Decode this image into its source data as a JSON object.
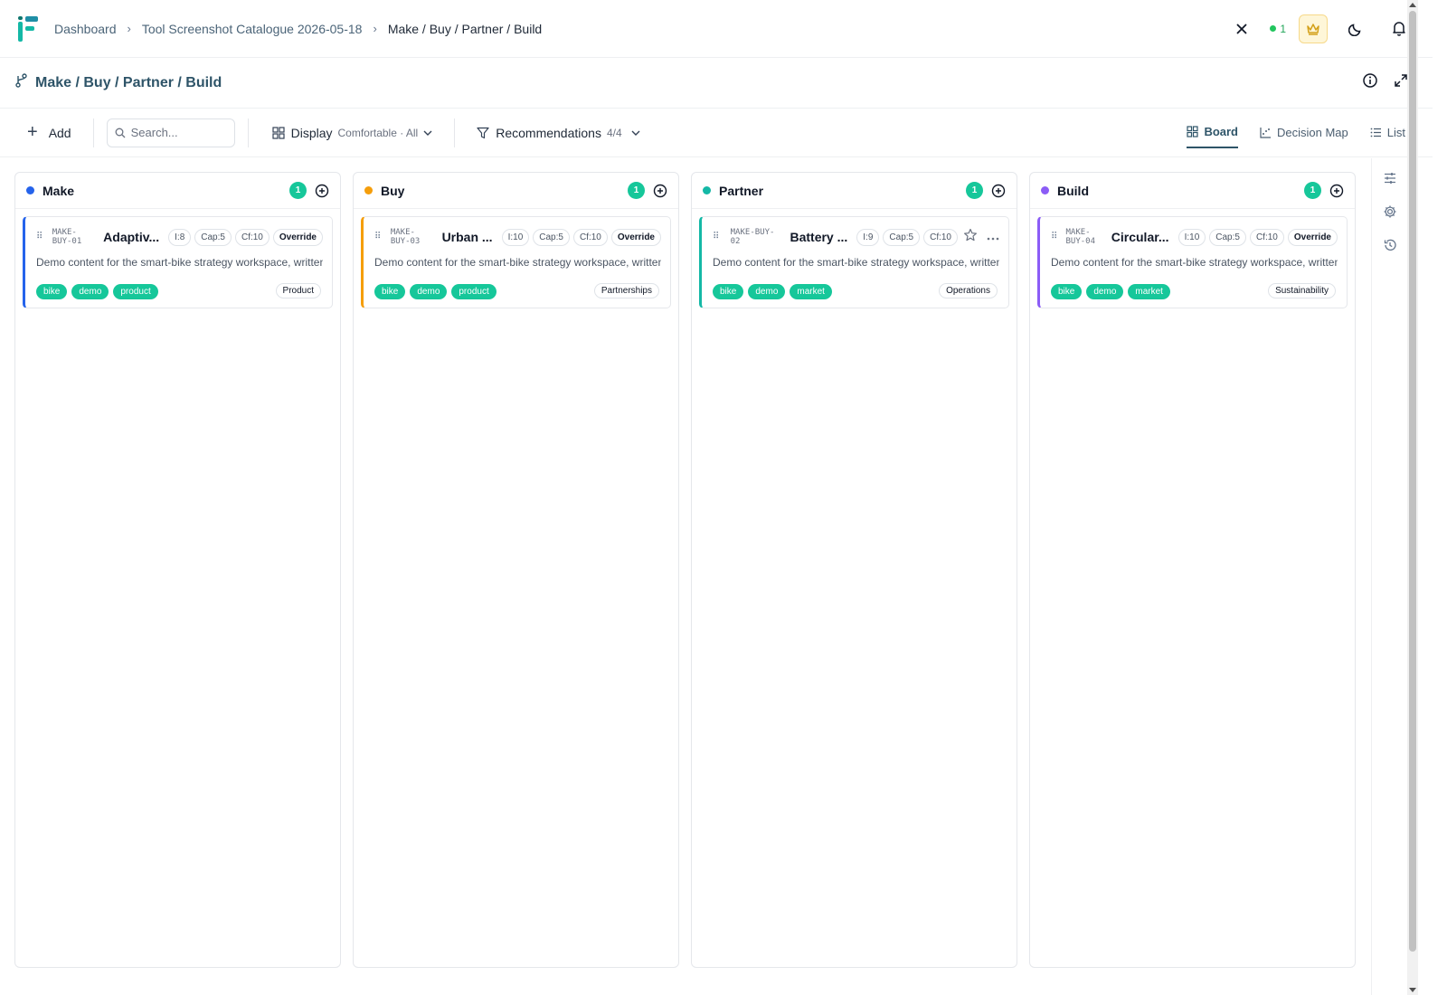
{
  "breadcrumbs": [
    "Dashboard",
    "Tool Screenshot Catalogue 2026-05-18",
    "Make / Buy / Partner / Build"
  ],
  "topbar": {
    "online_count": "1"
  },
  "page": {
    "title": "Make / Buy / Partner / Build"
  },
  "toolbar": {
    "add_label": "Add",
    "search_placeholder": "Search...",
    "display_label": "Display",
    "display_sub": "Comfortable · All",
    "recommendations_label": "Recommendations",
    "recommendations_count": "4/4",
    "views": [
      "Board",
      "Decision Map",
      "List"
    ],
    "active_view": "Board"
  },
  "columns": [
    {
      "title": "Make",
      "count": "1",
      "color": "#2563eb",
      "card": {
        "code": "MAKE-BUY-01",
        "title": "Adaptiv...",
        "pills": [
          "I:8",
          "Cap:5",
          "Cf:10",
          "Override"
        ],
        "desc": "Demo content for the smart-bike strategy workspace, written",
        "tags": [
          "bike",
          "demo",
          "product"
        ],
        "category": "Product"
      }
    },
    {
      "title": "Buy",
      "count": "1",
      "color": "#f59e0b",
      "card": {
        "code": "MAKE-BUY-03",
        "title": "Urban ...",
        "pills": [
          "I:10",
          "Cap:5",
          "Cf:10",
          "Override"
        ],
        "desc": "Demo content for the smart-bike strategy workspace, written",
        "tags": [
          "bike",
          "demo",
          "product"
        ],
        "category": "Partnerships"
      }
    },
    {
      "title": "Partner",
      "count": "1",
      "color": "#14b8a6",
      "card": {
        "code": "MAKE-BUY-02",
        "title": "Battery ...",
        "pills": [
          "I:9",
          "Cap:5",
          "Cf:10"
        ],
        "desc": "Demo content for the smart-bike strategy workspace, written",
        "tags": [
          "bike",
          "demo",
          "market"
        ],
        "category": "Operations"
      }
    },
    {
      "title": "Build",
      "count": "1",
      "color": "#8b5cf6",
      "card": {
        "code": "MAKE-BUY-04",
        "title": "Circular...",
        "pills": [
          "I:10",
          "Cap:5",
          "Cf:10",
          "Override"
        ],
        "desc": "Demo content for the smart-bike strategy workspace, written",
        "tags": [
          "bike",
          "demo",
          "market"
        ],
        "category": "Sustainability"
      }
    }
  ]
}
